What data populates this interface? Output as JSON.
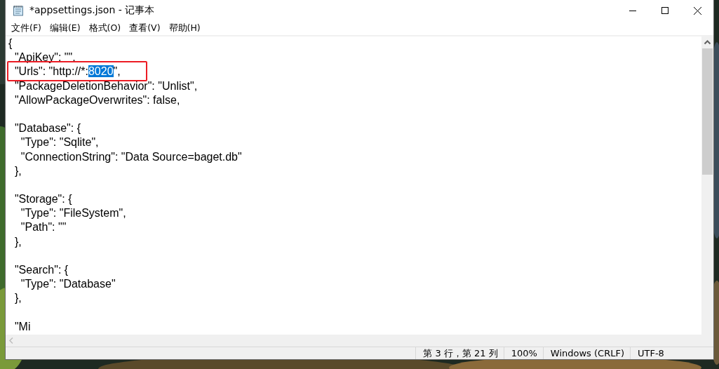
{
  "window": {
    "title": "*appsettings.json - 记事本"
  },
  "menu": [
    {
      "label": "文件(F)"
    },
    {
      "label": "编辑(E)"
    },
    {
      "label": "格式(O)"
    },
    {
      "label": "查看(V)"
    },
    {
      "label": "帮助(H)"
    }
  ],
  "editor": {
    "lines": [
      {
        "text": "{"
      },
      {
        "text": "  \"ApiKey\": \"\","
      },
      {
        "boxed": true,
        "segments": [
          {
            "text": "  \"Urls\": \"http://*:",
            "selected": false
          },
          {
            "text": "8020",
            "selected": true
          },
          {
            "text": "\",",
            "selected": false
          }
        ]
      },
      {
        "text": "  \"PackageDeletionBehavior\": \"Unlist\","
      },
      {
        "text": "  \"AllowPackageOverwrites\": false,"
      },
      {
        "text": "  \"Database\": {",
        "space_before": true
      },
      {
        "text": "    \"Type\": \"Sqlite\","
      },
      {
        "text": "    \"ConnectionString\": \"Data Source=baget.db\""
      },
      {
        "text": "  },"
      },
      {
        "text": "  \"Storage\": {",
        "space_before": true
      },
      {
        "text": "    \"Type\": \"FileSystem\","
      },
      {
        "text": "    \"Path\": \"\""
      },
      {
        "text": "  },"
      },
      {
        "text": "  \"Search\": {",
        "space_before": true
      },
      {
        "text": "    \"Type\": \"Database\""
      },
      {
        "text": "  },"
      },
      {
        "text": "  \"Mi",
        "space_before": true
      }
    ]
  },
  "status_bar": [
    "第 3 行，第 21 列",
    "100%",
    "Windows (CRLF)",
    "UTF-8"
  ]
}
